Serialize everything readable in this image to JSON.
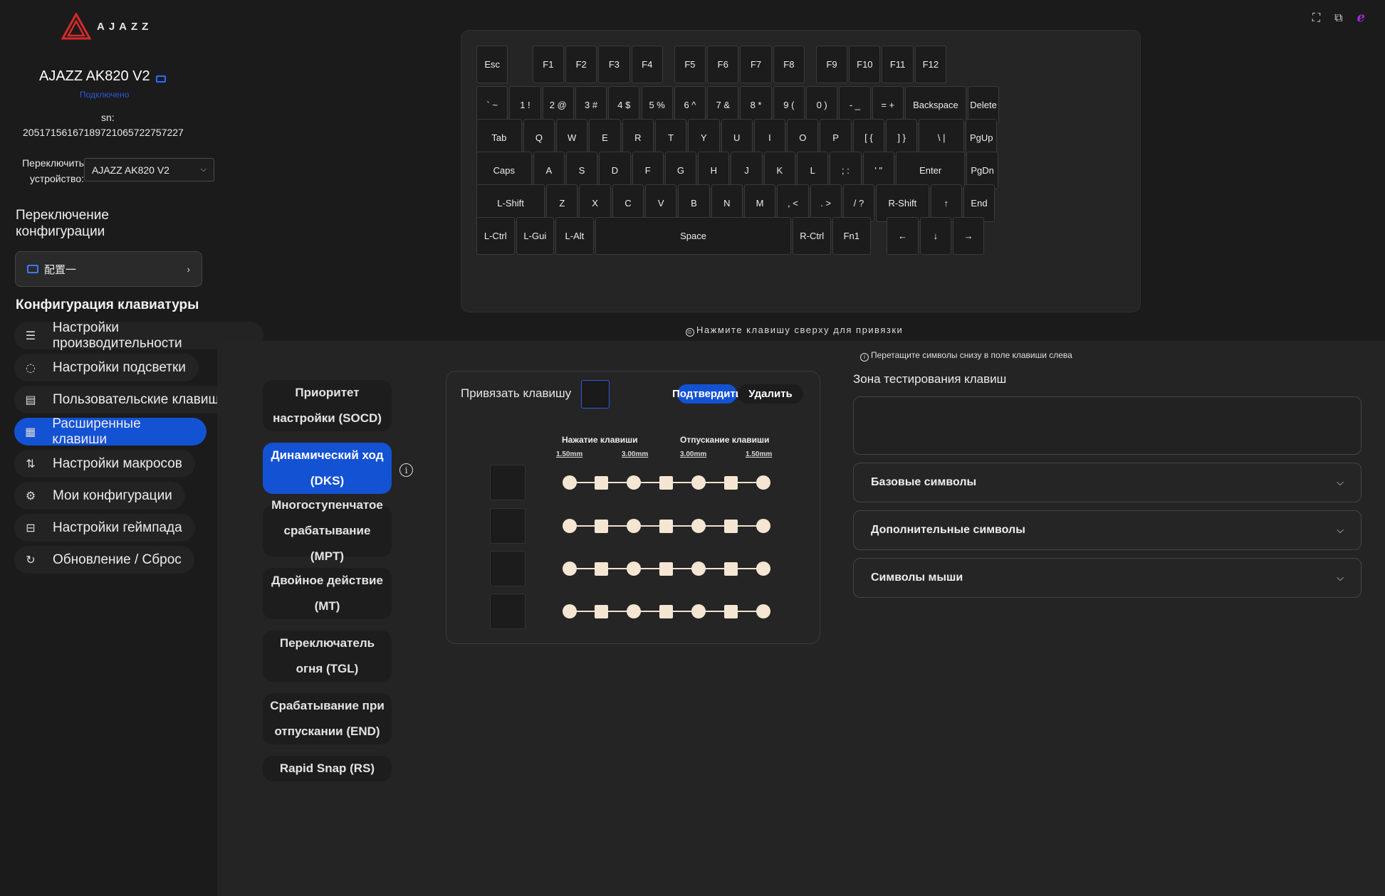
{
  "brand": {
    "logo_text": "AJAZZ"
  },
  "device": {
    "name": "AJAZZ AK820 V2",
    "status": "Подключено",
    "sn_label": "sn:",
    "sn_value": "205171561671897210657227572 27"
  },
  "switch_device": {
    "label": "Переключить устройство:",
    "selected": "AJAZZ AK820 V2"
  },
  "config_switch": {
    "title": "Переключение конфигурации",
    "selected": "配置一"
  },
  "kb_config": {
    "title": "Конфигурация клавиатуры",
    "items": [
      {
        "label": "Настройки производительности",
        "icon": "sliders-icon"
      },
      {
        "label": "Настройки подсветки",
        "icon": "bulb-icon"
      },
      {
        "label": "Пользовательские клавиши",
        "icon": "keyboard-icon"
      },
      {
        "label": "Расширенные клавиши",
        "icon": "grid-icon"
      },
      {
        "label": "Настройки макросов",
        "icon": "macro-icon"
      },
      {
        "label": "Мои конфигурации",
        "icon": "gear-icon"
      },
      {
        "label": "Настройки геймпада",
        "icon": "gamepad-icon"
      },
      {
        "label": "Обновление / Сброс",
        "icon": "refresh-icon"
      }
    ],
    "active_index": 3
  },
  "keyboard": {
    "rows": [
      [
        "Esc",
        "F1",
        "F2",
        "F3",
        "F4",
        "F5",
        "F6",
        "F7",
        "F8",
        "F9",
        "F10",
        "F11",
        "F12"
      ],
      [
        "` ~",
        "1 !",
        "2 @",
        "3 #",
        "4 $",
        "5 %",
        "6 ^",
        "7 &",
        "8 *",
        "9 (",
        "0 )",
        "- _",
        "= +",
        "Backspace",
        "Delete"
      ],
      [
        "Tab",
        "Q",
        "W",
        "E",
        "R",
        "T",
        "Y",
        "U",
        "I",
        "O",
        "P",
        "[ {",
        "] }",
        "\\ |",
        "PgUp"
      ],
      [
        "Caps",
        "A",
        "S",
        "D",
        "F",
        "G",
        "H",
        "J",
        "K",
        "L",
        "; :",
        "' \"",
        "Enter",
        "PgDn"
      ],
      [
        "L-Shift",
        "Z",
        "X",
        "C",
        "V",
        "B",
        "N",
        "M",
        ", <",
        ". >",
        "/ ?",
        "R-Shift",
        "↑",
        "End"
      ],
      [
        "L-Ctrl",
        "L-Gui",
        "L-Alt",
        "Space",
        "R-Ctrl",
        "Fn1",
        "←",
        "↓",
        "→"
      ]
    ],
    "hint": "Нажмите клавишу сверху для привязки"
  },
  "modes": {
    "items": [
      "Приоритет настройки (SOCD)",
      "Динамический ход (DKS)",
      "Многоступенчатое срабатывание (MPT)",
      "Двойное действие (MT)",
      "Переключатель огня (TGL)",
      "Срабатывание при отпускании (END)",
      "Rapid Snap (RS)"
    ],
    "active_index": 1
  },
  "dks": {
    "bind_label": "Привязать клавишу",
    "confirm": "Подтвердить",
    "delete": "Удалить",
    "press_header": "Нажатие клавиши",
    "release_header": "Отпускание клавиши",
    "distances": [
      "1.50mm",
      "3.00mm",
      "3.00mm",
      "1.50mm"
    ],
    "rows": 4
  },
  "right": {
    "drag_hint": "Перетащите символы снизу в поле клавиши слева",
    "test_title": "Зона тестирования клавиш",
    "sections": [
      "Базовые символы",
      "Дополнительные символы",
      "Символы мыши"
    ]
  },
  "colors": {
    "accent": "#1452d4",
    "node": "#f4e6d2",
    "background": "#1b1b1b"
  }
}
